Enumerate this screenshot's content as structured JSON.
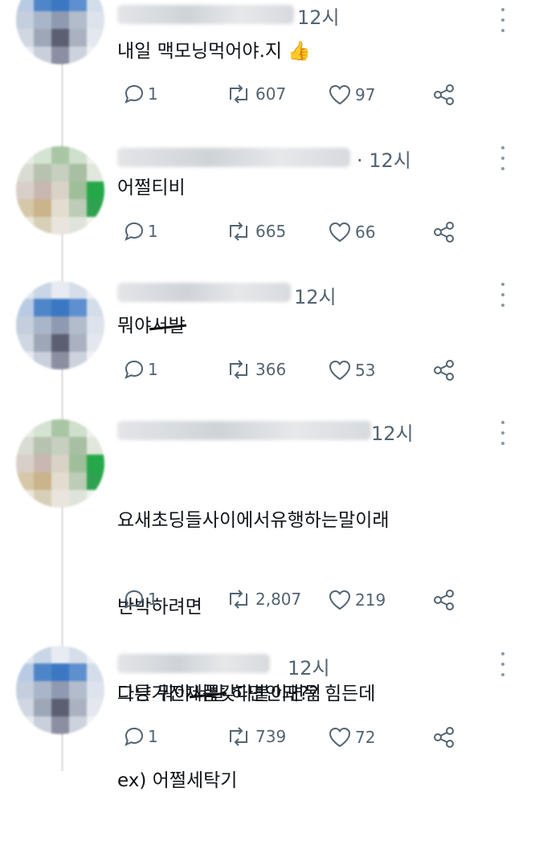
{
  "tweets": [
    {
      "time": "12시",
      "text_lines": [
        "내일 맥모닝먹어야.지 👍"
      ],
      "replies": "1",
      "retweets": "607",
      "likes": "97"
    },
    {
      "time": "· 12시",
      "text_lines": [
        "어쩔티비"
      ],
      "replies": "1",
      "retweets": "665",
      "likes": "66"
    },
    {
      "time": "12시",
      "text_prefix": "뭐야",
      "text_struck": "서발",
      "text_suffix": "",
      "replies": "1",
      "retweets": "366",
      "likes": "53"
    },
    {
      "time": "12시",
      "text_lines": [
        "요새초딩들사이에서유행하는말이래",
        "반박하려면",
        "다른가전제품갖다붙이면됨",
        "ex) 어쩔세탁기"
      ],
      "replies": "1",
      "retweets": "2,807",
      "likes": "219"
    },
    {
      "time": "12시",
      "text_prefix": "그냥 뭐야",
      "text_struck": "서발",
      "text_suffix": " 하면안돼?? 힘든데",
      "replies": "1",
      "retweets": "739",
      "likes": "72"
    }
  ],
  "icons": {
    "reply": "reply-icon",
    "retweet": "retweet-icon",
    "like": "heart-icon",
    "share": "share-icon",
    "more": "more-icon"
  }
}
